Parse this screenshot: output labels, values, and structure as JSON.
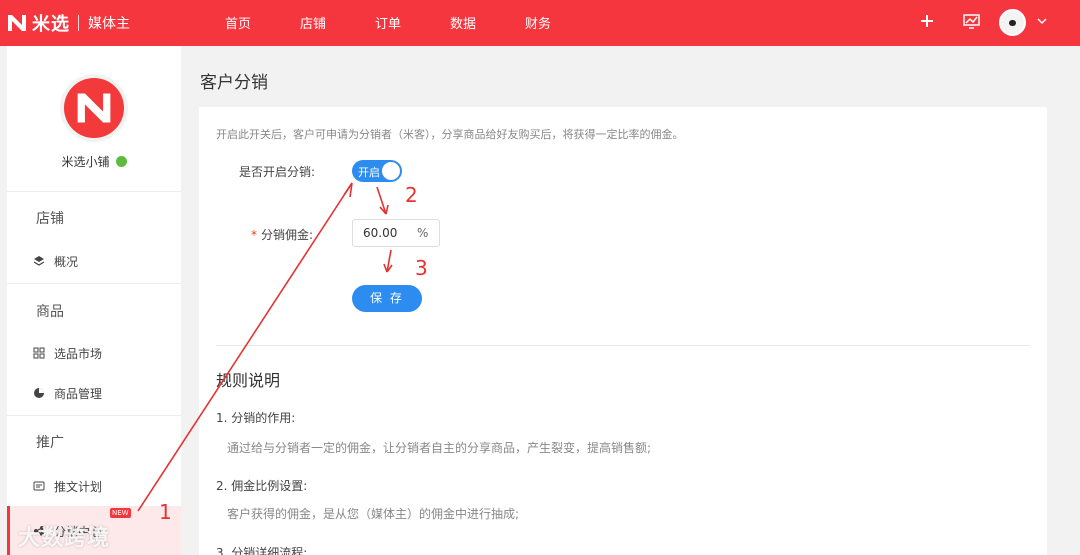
{
  "header": {
    "logo_text": "米选",
    "logo_sub": "媒体主",
    "nav": [
      "首页",
      "店铺",
      "订单",
      "数据",
      "财务"
    ]
  },
  "colors": {
    "brand": "#f5363f",
    "accent": "#2d8cf0"
  },
  "icons": [
    "plus-icon",
    "chart-icon",
    "chevron-down-icon",
    "shield-icon"
  ],
  "sidebar": {
    "shop_name": "米选小铺",
    "sections": [
      {
        "title": "店铺",
        "items": [
          {
            "label": "概况",
            "icon": "layers-icon"
          }
        ]
      },
      {
        "title": "商品",
        "items": [
          {
            "label": "选品市场",
            "icon": "grid-icon"
          },
          {
            "label": "商品管理",
            "icon": "pie-icon"
          }
        ]
      },
      {
        "title": "推广",
        "items": [
          {
            "label": "推文计划",
            "icon": "message-icon"
          },
          {
            "label": "分销中心",
            "icon": "share-icon",
            "badge": "NEW",
            "active": true
          }
        ]
      }
    ]
  },
  "main": {
    "title": "客户分销",
    "description": "开启此开关后，客户可申请为分销者（米客），分享商品给好友购买后，将获得一定比率的佣金。",
    "switch_label": "是否开启分销:",
    "switch_text": "开启",
    "commission_label": "分销佣金:",
    "commission_value": "60.00",
    "commission_unit": "%",
    "save_label": "保 存",
    "rules_title": "规则说明",
    "rules": [
      {
        "heading": "1. 分销的作用:",
        "text": "通过给与分销者一定的佣金，让分销者自主的分享商品，产生裂变，提高销售额;"
      },
      {
        "heading": "2. 佣金比例设置:",
        "text": "客户获得的佣金，是从您（媒体主）的佣金中进行抽成;"
      },
      {
        "heading": "3. 分销详细流程:",
        "text": ""
      }
    ]
  },
  "annotations": [
    "1",
    "2",
    "3"
  ],
  "watermark": "大数跨境"
}
